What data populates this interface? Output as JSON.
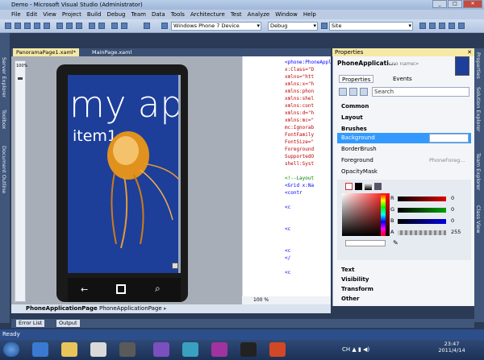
{
  "window": {
    "title": "Demo - Microsoft Visual Studio (Administrator)",
    "controls": [
      "_",
      "□",
      "✕"
    ]
  },
  "menu": [
    "File",
    "Edit",
    "View",
    "Project",
    "Build",
    "Debug",
    "Team",
    "Data",
    "Tools",
    "Architecture",
    "Test",
    "Analyze",
    "Window",
    "Help"
  ],
  "toolbar": {
    "device": "Windows Phone 7 Device",
    "config": "Debug",
    "find": "Site"
  },
  "left_dock": [
    "Server Explorer",
    "Toolbox",
    "Document Outline"
  ],
  "right_dock": [
    "Properties",
    "Solution Explorer",
    "Team Explorer",
    "Class View"
  ],
  "doc_tabs": [
    "PanoramaPage1.xaml*",
    "MainPage.xaml"
  ],
  "designer": {
    "zoom_label": "100%",
    "title_text": "my ap",
    "item_text": "item1",
    "nav_icons": [
      "back-icon",
      "windows-icon",
      "search-icon"
    ]
  },
  "editor": {
    "lines": [
      {
        "n": "",
        "t": "<phone:PhoneAppl",
        "c": "blue"
      },
      {
        "n": "",
        "t": "x:Class=\"D",
        "c": "red"
      },
      {
        "n": "",
        "t": "xmlns=\"htt",
        "c": "red"
      },
      {
        "n": "",
        "t": "xmlns:x=\"h",
        "c": "red"
      },
      {
        "n": "",
        "t": "xmlns:phon",
        "c": "red"
      },
      {
        "n": "",
        "t": "xmlns:shel",
        "c": "red"
      },
      {
        "n": "",
        "t": "xmlns:cont",
        "c": "red"
      },
      {
        "n": "",
        "t": "xmlns:d=\"h",
        "c": "red"
      },
      {
        "n": "",
        "t": "xmlns:mc=\"",
        "c": "red"
      },
      {
        "n": "",
        "t": "mc:Ignorab",
        "c": "red"
      },
      {
        "n": "",
        "t": "FontFamily",
        "c": "red"
      },
      {
        "n": "",
        "t": "FontSize=\"",
        "c": "red"
      },
      {
        "n": "",
        "t": "Foreground",
        "c": "red"
      },
      {
        "n": "",
        "t": "SupportedO",
        "c": "red"
      },
      {
        "n": "",
        "t": "shell:Syst",
        "c": "red"
      },
      {
        "n": "",
        "t": "",
        "c": "red"
      },
      {
        "n": "",
        "t": "<!--Layout",
        "c": "green"
      },
      {
        "n": "",
        "t": "<Grid x:Na",
        "c": "blue"
      },
      {
        "n": "",
        "t": "  <contr",
        "c": "blue"
      },
      {
        "n": "",
        "t": "",
        "c": "blue"
      },
      {
        "n": "",
        "t": "    <c",
        "c": "blue"
      },
      {
        "n": "",
        "t": "",
        "c": "blue"
      },
      {
        "n": "",
        "t": "",
        "c": "blue"
      },
      {
        "n": "",
        "t": "    <c",
        "c": "blue"
      },
      {
        "n": "",
        "t": "",
        "c": "blue"
      },
      {
        "n": "",
        "t": "",
        "c": "blue"
      },
      {
        "n": "",
        "t": "    <c",
        "c": "blue"
      },
      {
        "n": "",
        "t": "    </",
        "c": "blue"
      },
      {
        "n": "",
        "t": "",
        "c": "blue"
      },
      {
        "n": "",
        "t": "    <c",
        "c": "blue"
      }
    ],
    "zoom": "100 %"
  },
  "breadcrumb": {
    "item1": "PhoneApplicationPage",
    "item2": "PhoneApplicationPage"
  },
  "bottom_tabs": [
    "Error List",
    "Output"
  ],
  "status": "Ready",
  "clock": {
    "time": "23:47",
    "date": "2011/4/14"
  },
  "properties": {
    "title": "Properties",
    "name": "PhoneApplicati...",
    "noname": "<no name>",
    "tabs": [
      "Properties",
      "Events"
    ],
    "search_placeholder": "Search",
    "categories": [
      "Common",
      "Layout",
      "Brushes"
    ],
    "brush_rows": [
      {
        "label": "Background",
        "value": ""
      },
      {
        "label": "BorderBrush",
        "value": ""
      },
      {
        "label": "Foreground",
        "value": "PhoneForeg..."
      },
      {
        "label": "OpacityMask",
        "value": ""
      }
    ],
    "channels": [
      {
        "name": "R",
        "value": "0",
        "color": "#e00000"
      },
      {
        "name": "G",
        "value": "0",
        "color": "#00a000"
      },
      {
        "name": "B",
        "value": "0",
        "color": "#0000e0"
      },
      {
        "name": "A",
        "value": "255",
        "color": "#888"
      }
    ],
    "more_categories": [
      "Text",
      "Visibility",
      "Transform",
      "Other"
    ]
  }
}
